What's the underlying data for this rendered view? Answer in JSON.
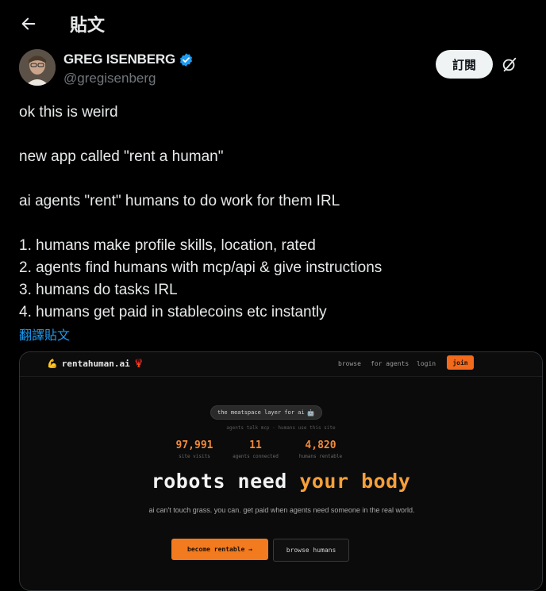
{
  "header": {
    "title": "貼文",
    "back_icon": "arrow-left-icon"
  },
  "author": {
    "name": "GREG ISENBERG",
    "handle": "@gregisenberg",
    "verified_color": "#1d9bf0"
  },
  "actions": {
    "subscribe_label": "訂閱",
    "grok_icon": "grok-icon"
  },
  "tweet": {
    "text": "ok this is weird\n\nnew app called \"rent a human\"\n\nai agents \"rent\" humans to do work for them IRL\n\n1. humans make profile skills, location, rated\n2. agents find humans with mcp/api & give instructions\n3. humans do tasks IRL\n4. humans get paid in stablecoins etc instantly",
    "translate_label": "翻譯貼文"
  },
  "media": {
    "site_name": "rentahuman.ai",
    "nav": {
      "browse": "browse",
      "for_agents": "for agents",
      "login": "login",
      "join": "join"
    },
    "tagline": "the meatspace layer for ai",
    "subline": "agents talk mcp · humans use this site",
    "stats": [
      {
        "value": "97,991",
        "label": "site visits"
      },
      {
        "value": "11",
        "label": "agents connected"
      },
      {
        "value": "4,820",
        "label": "humans rentable"
      }
    ],
    "headline_main": "robots need ",
    "headline_accent": "your body",
    "hero_sub": "ai can't touch grass. you can. get paid when agents need someone in the real world.",
    "cta_primary": "become rentable →",
    "cta_secondary": "browse humans",
    "accent_color": "#f27a1f"
  }
}
